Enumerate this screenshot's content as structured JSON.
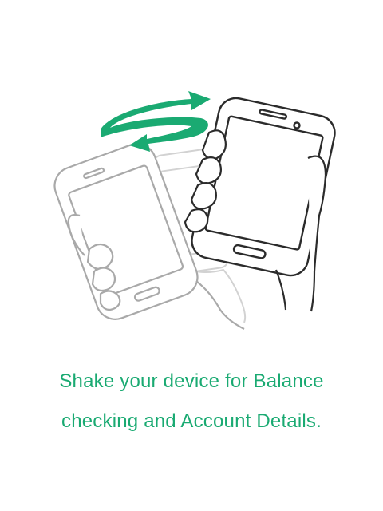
{
  "illustration": {
    "icon": "shake-device-icon",
    "accent_color": "#1aaa72",
    "line_color": "#2b2b2b",
    "ghost_color": "#b8b8b8"
  },
  "caption": {
    "line1": "Shake your device for Balance",
    "line2": "checking and Account Details."
  }
}
